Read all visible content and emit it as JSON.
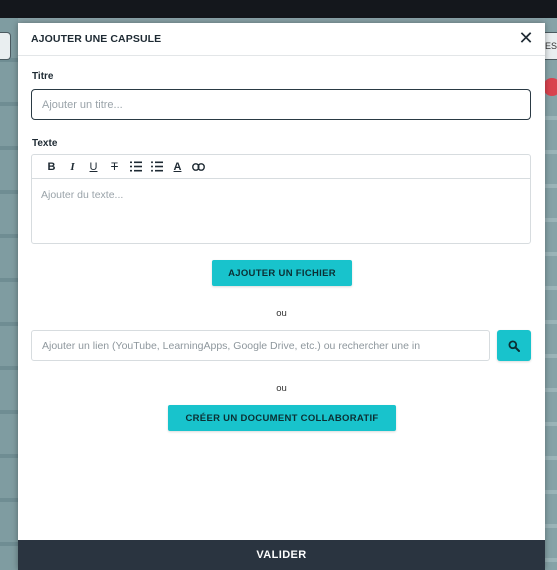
{
  "modal": {
    "title": "AJOUTER UNE CAPSULE",
    "close_label": "✕"
  },
  "background": {
    "right_tab_text": "ES"
  },
  "form": {
    "title_label": "Titre",
    "title_placeholder": "Ajouter un titre...",
    "text_label": "Texte",
    "text_placeholder": "Ajouter du texte...",
    "toolbar": {
      "bold": "B",
      "italic": "I",
      "underline": "U",
      "strikethrough": "T",
      "text_color": "A"
    },
    "add_file_label": "AJOUTER UN FICHIER",
    "or_1": "ou",
    "link_placeholder": "Ajouter un lien (YouTube, LearningApps, Google Drive, etc.) ou rechercher une in",
    "or_2": "ou",
    "collab_doc_label": "CRÉER UN DOCUMENT COLLABORATIF",
    "submit_label": "VALIDER"
  },
  "colors": {
    "accent": "#18c3cc",
    "footer": "#2a3440"
  }
}
